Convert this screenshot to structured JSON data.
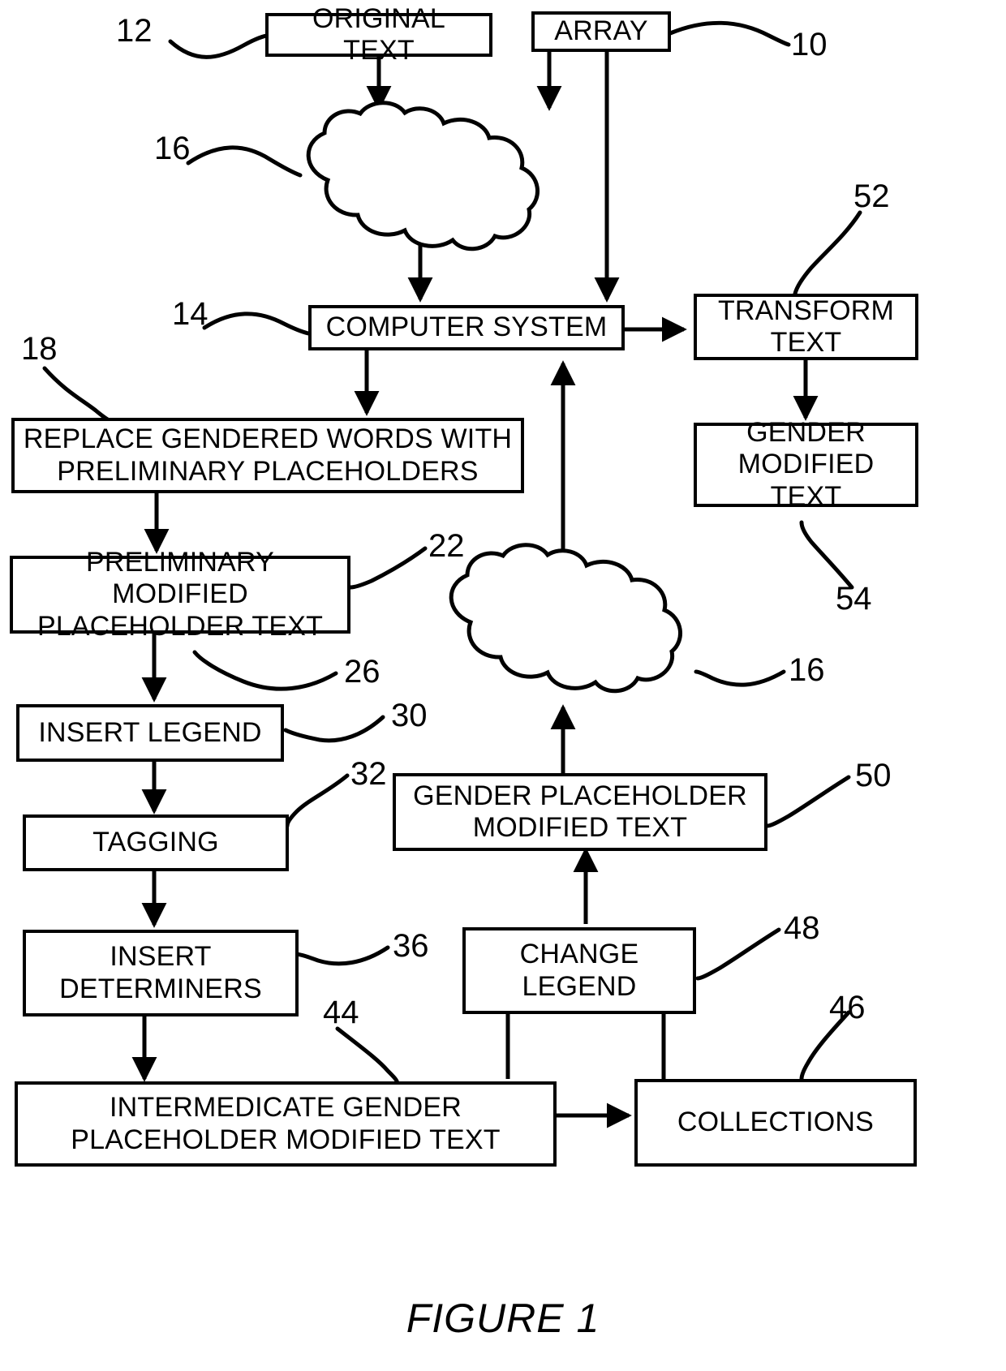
{
  "figure": {
    "caption": "FIGURE 1"
  },
  "nodes": [
    {
      "id": "original_text",
      "label": "ORIGINAL TEXT"
    },
    {
      "id": "array",
      "label": "ARRAY"
    },
    {
      "id": "computer_system",
      "label": "COMPUTER SYSTEM"
    },
    {
      "id": "transform_text",
      "label": "TRANSFORM\nTEXT"
    },
    {
      "id": "gender_modified_text",
      "label": "GENDER\nMODIFIED TEXT"
    },
    {
      "id": "replace_gendered_words",
      "label": "REPLACE GENDERED WORDS WITH\nPRELIMINARY PLACEHOLDERS"
    },
    {
      "id": "preliminary_modified",
      "label": "PRELIMINARY MODIFIED\nPLACEHOLDER TEXT"
    },
    {
      "id": "insert_legend",
      "label": "INSERT LEGEND"
    },
    {
      "id": "tagging",
      "label": "TAGGING"
    },
    {
      "id": "insert_determiners",
      "label": "INSERT\nDETERMINERS"
    },
    {
      "id": "intermediate_text",
      "label": "INTERMEDICATE GENDER\nPLACEHOLDER MODIFIED TEXT"
    },
    {
      "id": "collections",
      "label": "COLLECTIONS"
    },
    {
      "id": "change_legend",
      "label": "CHANGE\nLEGEND"
    },
    {
      "id": "gender_placeholder_text",
      "label": "GENDER PLACEHOLDER\nMODIFIED TEXT"
    }
  ],
  "clouds": [
    {
      "id": "network_top",
      "label": "16"
    },
    {
      "id": "network_bottom",
      "label": "16"
    }
  ],
  "reference_numerals": [
    {
      "id": "ref-12",
      "label": "12"
    },
    {
      "id": "ref-10",
      "label": "10"
    },
    {
      "id": "ref-16-top",
      "label": "16"
    },
    {
      "id": "ref-52",
      "label": "52"
    },
    {
      "id": "ref-14",
      "label": "14"
    },
    {
      "id": "ref-18",
      "label": "18"
    },
    {
      "id": "ref-22",
      "label": "22"
    },
    {
      "id": "ref-54",
      "label": "54"
    },
    {
      "id": "ref-26",
      "label": "26"
    },
    {
      "id": "ref-30",
      "label": "30"
    },
    {
      "id": "ref-16-bottom",
      "label": "16"
    },
    {
      "id": "ref-32",
      "label": "32"
    },
    {
      "id": "ref-50",
      "label": "50"
    },
    {
      "id": "ref-36",
      "label": "36"
    },
    {
      "id": "ref-48",
      "label": "48"
    },
    {
      "id": "ref-46",
      "label": "46"
    },
    {
      "id": "ref-44",
      "label": "44"
    }
  ],
  "colors": {
    "ink": "#000000",
    "paper": "#ffffff"
  }
}
